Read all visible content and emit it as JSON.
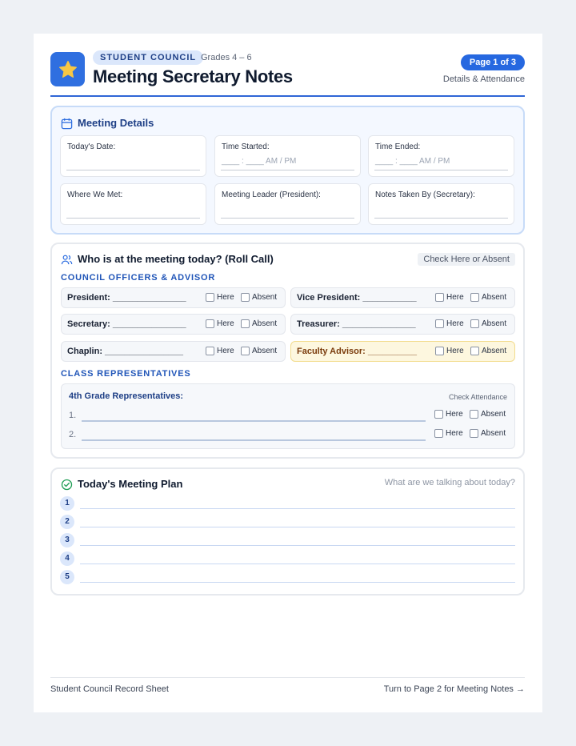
{
  "header": {
    "tag": "STUDENT COUNCIL",
    "grades": "Grades 4 – 6",
    "title": "Meeting Secretary Notes",
    "page_badge": "Page 1 of 3",
    "page_sub": "Details & Attendance",
    "icon": "star-icon"
  },
  "details": {
    "title": "Meeting Details",
    "icon": "calendar-icon",
    "fields": [
      {
        "label": "Today's Date:",
        "hint": ""
      },
      {
        "label": "Time Started:",
        "hint": "____ : ____  AM / PM"
      },
      {
        "label": "Time Ended:",
        "hint": "____ : ____  AM / PM"
      },
      {
        "label": "Where We Met:",
        "hint": ""
      },
      {
        "label": "Meeting Leader (President):",
        "hint": ""
      },
      {
        "label": "Notes Taken By (Secretary):",
        "hint": ""
      }
    ]
  },
  "roll_call": {
    "title": "Who is at the meeting today? (Roll Call)",
    "icon": "users-icon",
    "pill": "Check Here or Absent",
    "officers_heading": "COUNCIL OFFICERS & ADVISOR",
    "here_label": "Here",
    "absent_label": "Absent",
    "officers": [
      {
        "label": "President: _______________"
      },
      {
        "label": "Vice President: ___________"
      },
      {
        "label": "Secretary: _______________"
      },
      {
        "label": "Treasurer: _______________"
      },
      {
        "label": "Chaplin: ________________"
      },
      {
        "label": "Faculty Advisor: __________"
      }
    ],
    "reps_heading": "CLASS REPRESENTATIVES",
    "reps_title": "4th Grade Representatives:",
    "reps_check": "Check Attendance",
    "reps_numbers": [
      "1.",
      "2."
    ]
  },
  "plan": {
    "title": "Today's Meeting Plan",
    "icon": "check-circle-icon",
    "subtitle": "What are we talking about today?",
    "numbers": [
      "1",
      "2",
      "3",
      "4",
      "5"
    ]
  },
  "footer": {
    "left": "Student Council Record Sheet",
    "right": "Turn to Page 2 for Meeting Notes →"
  },
  "colors": {
    "accent": "#2f6fe0",
    "star": "#f7c744",
    "advisor_highlight": "#fdf7df"
  }
}
